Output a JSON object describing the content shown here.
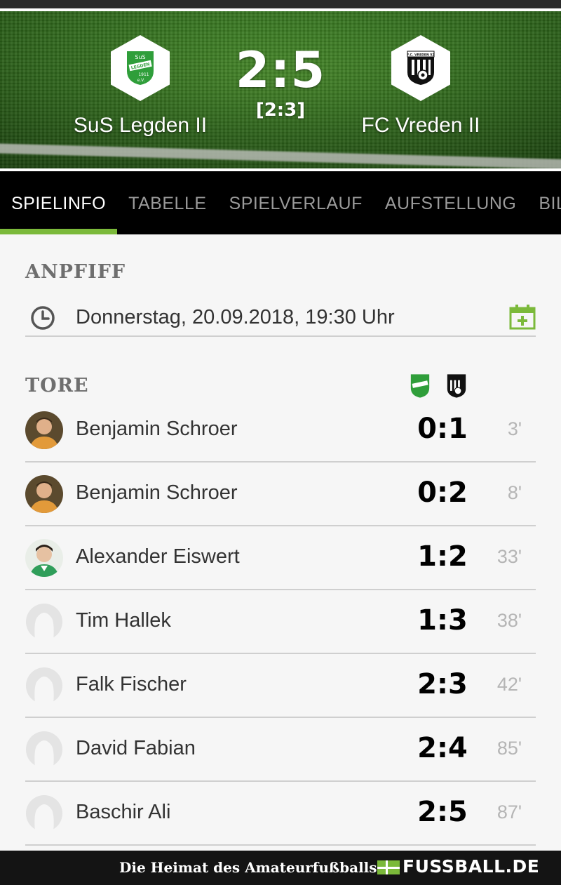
{
  "match": {
    "home_team": "SuS Legden II",
    "away_team": "FC Vreden II",
    "score": "2:5",
    "halftime": "[2:3]",
    "home_crest_text": [
      "SuS",
      "LEGDEN",
      "1911",
      "e.V."
    ],
    "away_crest_text": "F.C. VREDEN 52"
  },
  "tabs": [
    {
      "label": "SPIELINFO",
      "active": true
    },
    {
      "label": "TABELLE",
      "active": false
    },
    {
      "label": "SPIELVERLAUF",
      "active": false
    },
    {
      "label": "AUFSTELLUNG",
      "active": false
    },
    {
      "label": "BILDER",
      "active": false
    }
  ],
  "kickoff": {
    "title": "ANPFIFF",
    "datetime": "Donnerstag, 20.09.2018, 19:30 Uhr",
    "clock_icon": "clock-icon",
    "calendar_icon": "calendar-add-icon"
  },
  "goals_section": {
    "title": "TORE",
    "goals": [
      {
        "player": "Benjamin Schroer",
        "score": "0:1",
        "minute": "3'",
        "avatar": "photo-orange"
      },
      {
        "player": "Benjamin Schroer",
        "score": "0:2",
        "minute": "8'",
        "avatar": "photo-orange"
      },
      {
        "player": "Alexander Eiswert",
        "score": "1:2",
        "minute": "33'",
        "avatar": "photo-green"
      },
      {
        "player": "Tim Hallek",
        "score": "1:3",
        "minute": "38'",
        "avatar": "placeholder"
      },
      {
        "player": "Falk Fischer",
        "score": "2:3",
        "minute": "42'",
        "avatar": "placeholder"
      },
      {
        "player": "David Fabian",
        "score": "2:4",
        "minute": "85'",
        "avatar": "placeholder"
      },
      {
        "player": "Baschir Ali",
        "score": "2:5",
        "minute": "87'",
        "avatar": "placeholder"
      }
    ]
  },
  "footer": {
    "tagline": "Die Heimat des Amateurfußballs",
    "brand": "FUSSBALL.DE"
  },
  "colors": {
    "accent": "#7bb93a",
    "tab_bar": "#000000",
    "home_green": "#2f9e3a",
    "text_dark": "#333333",
    "muted": "#b5b5b5"
  }
}
